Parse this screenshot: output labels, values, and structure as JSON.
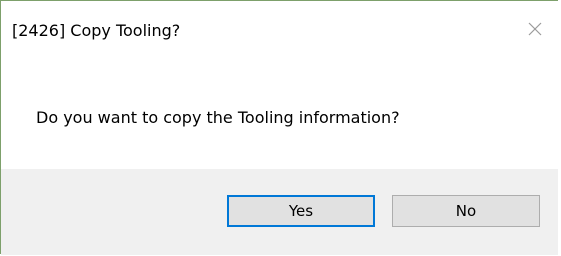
{
  "dialog": {
    "title": "[2426] Copy Tooling?",
    "close_icon": "close-icon",
    "message": "Do you want to copy the Tooling information?",
    "buttons": {
      "yes_label": "Yes",
      "no_label": "No"
    }
  },
  "colors": {
    "frame_border": "#7da06b",
    "default_button_border": "#0078d7",
    "footer_background": "#f0f0f0",
    "button_background": "#e1e1e1"
  }
}
